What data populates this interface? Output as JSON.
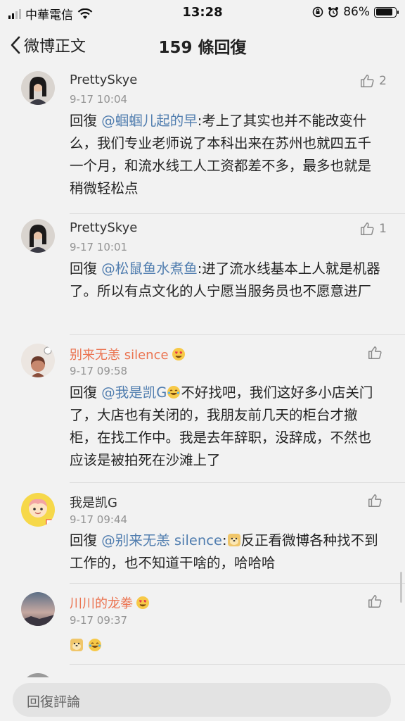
{
  "status": {
    "carrier": "中華電信",
    "time": "13:28",
    "battery": "86%",
    "battery_level": 0.86
  },
  "nav": {
    "back_label": "微博正文",
    "title": "159 條回復"
  },
  "comments": [
    {
      "user": "PrettySkye",
      "time": "9-17 10:04",
      "likes": "2",
      "prefix": "回復 ",
      "mention": "@蝈蝈儿起的早",
      "text": ":考上了其实也并不能改变什么，我们专业老师说了本科出来在苏州也就四五千一个月，和流水线工人工资都差不多，最多也就是稍微轻松点"
    },
    {
      "user": "PrettySkye",
      "time": "9-17 10:01",
      "likes": "1",
      "prefix": "回復 ",
      "mention": "@松鼠鱼水煮鱼",
      "text": ":进了流水线基本上人就是机器了。所以有点文化的人宁愿当服务员也不愿意进厂"
    },
    {
      "user": "别来无恙 silence",
      "time": "9-17 09:58",
      "likes": "",
      "prefix": "回復 ",
      "mention": "@我是凯G",
      "text": "不好找吧，我们这好多小店关门了，大店也有关闭的，我朋友前几天的柜台才撤柜，在找工作中。我是去年辞职，没辞成，不然也应该是被拍死在沙滩上了"
    },
    {
      "user": "我是凯G",
      "time": "9-17 09:44",
      "likes": "",
      "prefix": "回復 ",
      "mention": "@别来无恙 silence",
      "text": "反正看微博各种找不到工作的，也不知道干啥的，哈哈哈"
    },
    {
      "user": "川川的龙拳",
      "time": "9-17 09:37",
      "likes": "",
      "prefix": "",
      "mention": "",
      "text": ""
    }
  ],
  "reply": {
    "placeholder": "回復評論"
  },
  "colors": {
    "mention": "#507daf",
    "vip_name": "#eb7350",
    "background": "#f2f2f2"
  }
}
